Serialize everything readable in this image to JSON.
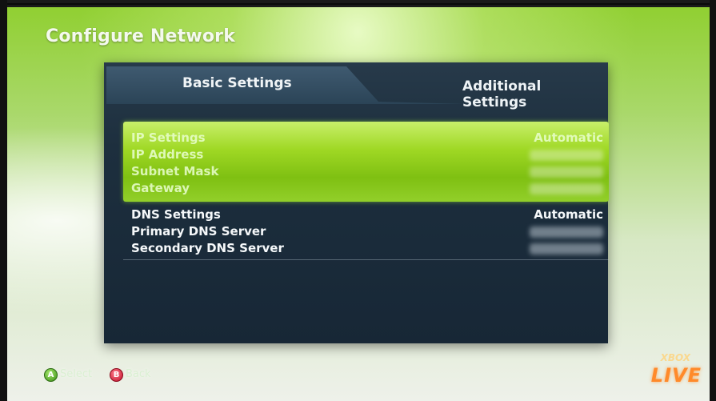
{
  "page": {
    "title": "Configure Network"
  },
  "tabs": [
    {
      "label": "Basic Settings",
      "selected": true
    },
    {
      "label": "Additional Settings",
      "selected": false
    }
  ],
  "highlighted_group": [
    {
      "label": "IP Settings",
      "value": "Automatic"
    },
    {
      "label": "IP Address",
      "value": ""
    },
    {
      "label": "Subnet Mask",
      "value": ""
    },
    {
      "label": "Gateway",
      "value": ""
    }
  ],
  "dns_group": [
    {
      "label": "DNS Settings",
      "value": "Automatic"
    },
    {
      "label": "Primary DNS Server",
      "value": ""
    },
    {
      "label": "Secondary DNS Server",
      "value": ""
    }
  ],
  "hints": [
    {
      "button": "A",
      "label": "Select"
    },
    {
      "button": "B",
      "label": "Back"
    }
  ],
  "logo": {
    "top": "XBOX",
    "bottom": "LIVE"
  },
  "colors": {
    "accent_green": "#9fd824",
    "panel": "#1d2f3e",
    "b_button": "#c0102a",
    "a_button": "#3a8e14",
    "logo_orange": "#ff8a2a"
  }
}
